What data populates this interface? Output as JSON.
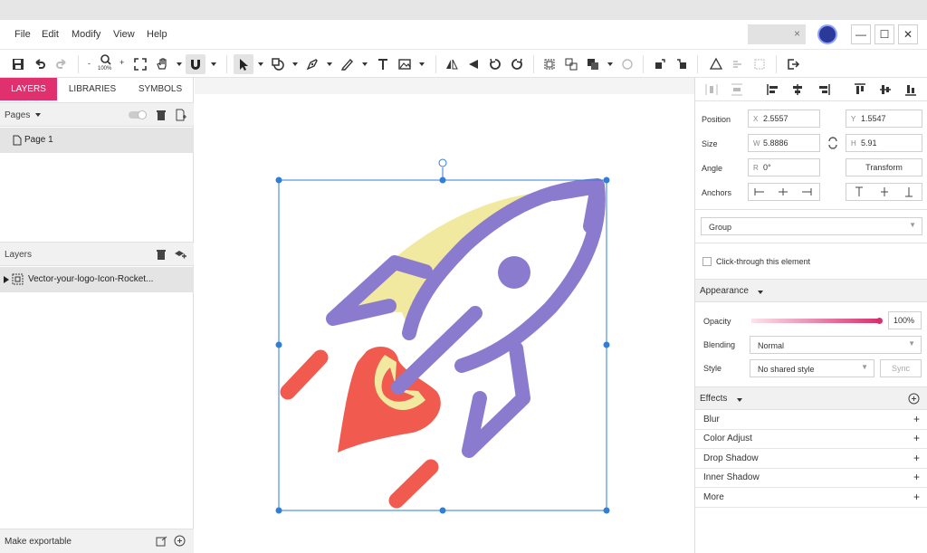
{
  "menu": {
    "items": [
      "File",
      "Edit",
      "Modify",
      "View",
      "Help"
    ]
  },
  "window": {
    "search_close": "×",
    "minimize": "—",
    "maximize": "☐",
    "close": "✕"
  },
  "toolbar": {
    "zoom_label": "100%",
    "zoom_minus": "-",
    "zoom_plus": "+"
  },
  "left": {
    "tabs": [
      "LAYERS",
      "LIBRARIES",
      "SYMBOLS"
    ],
    "pages_label": "Pages",
    "page_name": "Page 1",
    "layers_label": "Layers",
    "layer_name": "Vector-your-logo-Icon-Rocket...",
    "export_label": "Make exportable"
  },
  "right": {
    "position_label": "Position",
    "pos_x_prefix": "X",
    "pos_x": "2.5557",
    "pos_y_prefix": "Y",
    "pos_y": "1.5547",
    "size_label": "Size",
    "w_prefix": "W",
    "w": "5.8886",
    "h_prefix": "H",
    "h": "5.91",
    "angle_label": "Angle",
    "r_prefix": "R",
    "angle": "0°",
    "transform_btn": "Transform",
    "anchors_label": "Anchors",
    "group_select": "Group",
    "clickthrough_label": "Click-through this element",
    "appearance_label": "Appearance",
    "opacity_label": "Opacity",
    "opacity_value": "100%",
    "opacity_fraction": 1.0,
    "blending_label": "Blending",
    "blending_value": "Normal",
    "style_label": "Style",
    "style_value": "No shared style",
    "sync_btn": "Sync",
    "effects_label": "Effects",
    "effects": [
      "Blur",
      "Color Adjust",
      "Drop Shadow",
      "Inner Shadow",
      "More"
    ]
  },
  "colors": {
    "accent_tab": "#e0306e",
    "selection": "#2f7ed8",
    "rocket_purple": "#8b7bcf",
    "rocket_yellow": "#f2e9a0",
    "flame_red": "#f05a4f"
  }
}
